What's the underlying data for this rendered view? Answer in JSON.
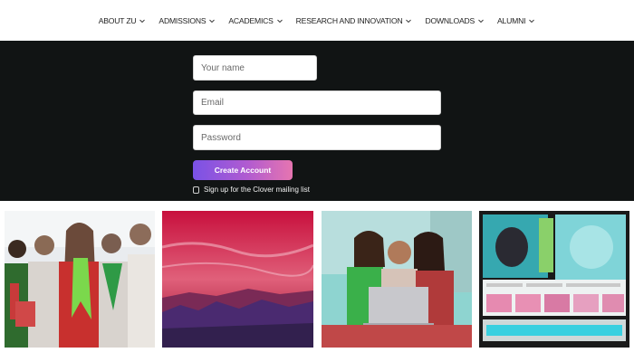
{
  "nav": {
    "items": [
      {
        "label": "ABOUT ZU"
      },
      {
        "label": "ADMISSIONS"
      },
      {
        "label": "ACADEMICS"
      },
      {
        "label": "RESEARCH AND INNOVATION"
      },
      {
        "label": "DOWNLOADS"
      },
      {
        "label": "ALUMNI"
      }
    ],
    "dropdown_icon": "chevron-down-icon"
  },
  "signup": {
    "name_placeholder": "Your name",
    "email_placeholder": "Email",
    "password_placeholder": "Password",
    "submit_label": "Create Account",
    "optin_label": "Sign up for the Clover mailing list"
  },
  "colors": {
    "band": "#111414",
    "button_start": "#7a52e6",
    "button_end": "#e675b0"
  }
}
